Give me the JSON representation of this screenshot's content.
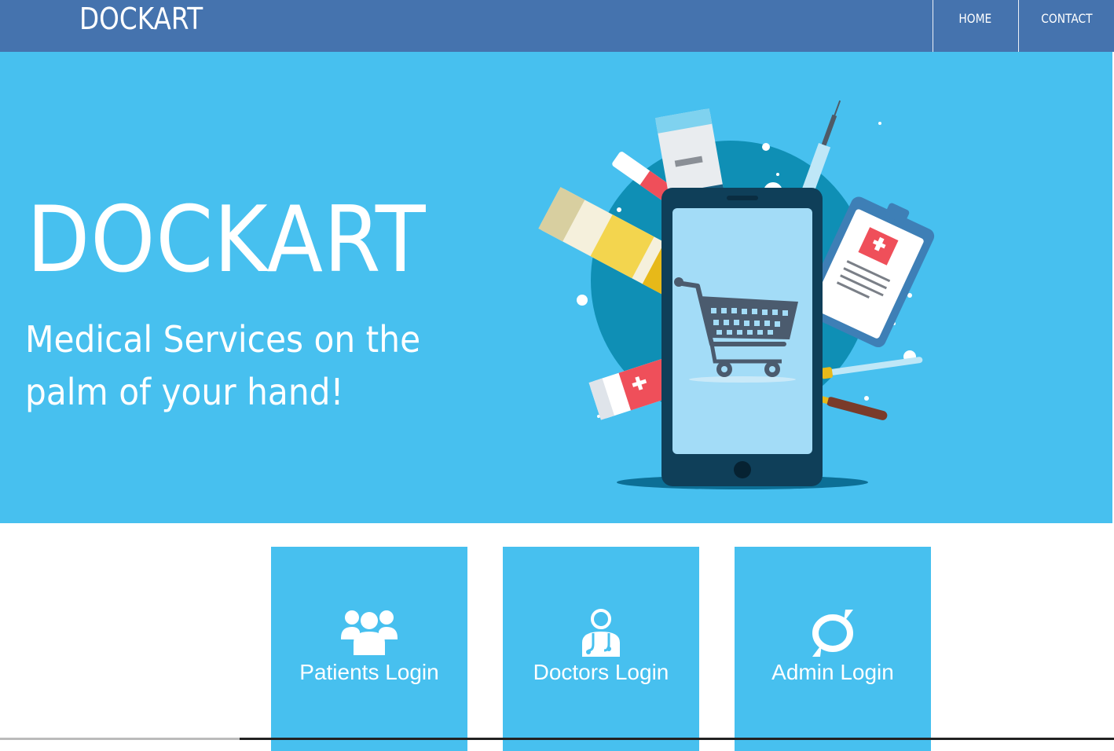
{
  "navbar": {
    "brand": "DOCKART",
    "links": [
      {
        "label": "HOME"
      },
      {
        "label": "CONTACT"
      }
    ],
    "color": "#4573ae"
  },
  "hero": {
    "title": "DOCKART",
    "subtitle_line1": "Medical Services on the",
    "subtitle_line2": "palm of your hand!",
    "background": "#47c0ef",
    "illustration": "smartphone-shopping-cart-with-medicines"
  },
  "cards": [
    {
      "label": "Patients Login",
      "icon": "patients-group-icon"
    },
    {
      "label": "Doctors Login",
      "icon": "doctor-stethoscope-icon"
    },
    {
      "label": "Admin Login",
      "icon": "admin-ring-icon"
    }
  ]
}
